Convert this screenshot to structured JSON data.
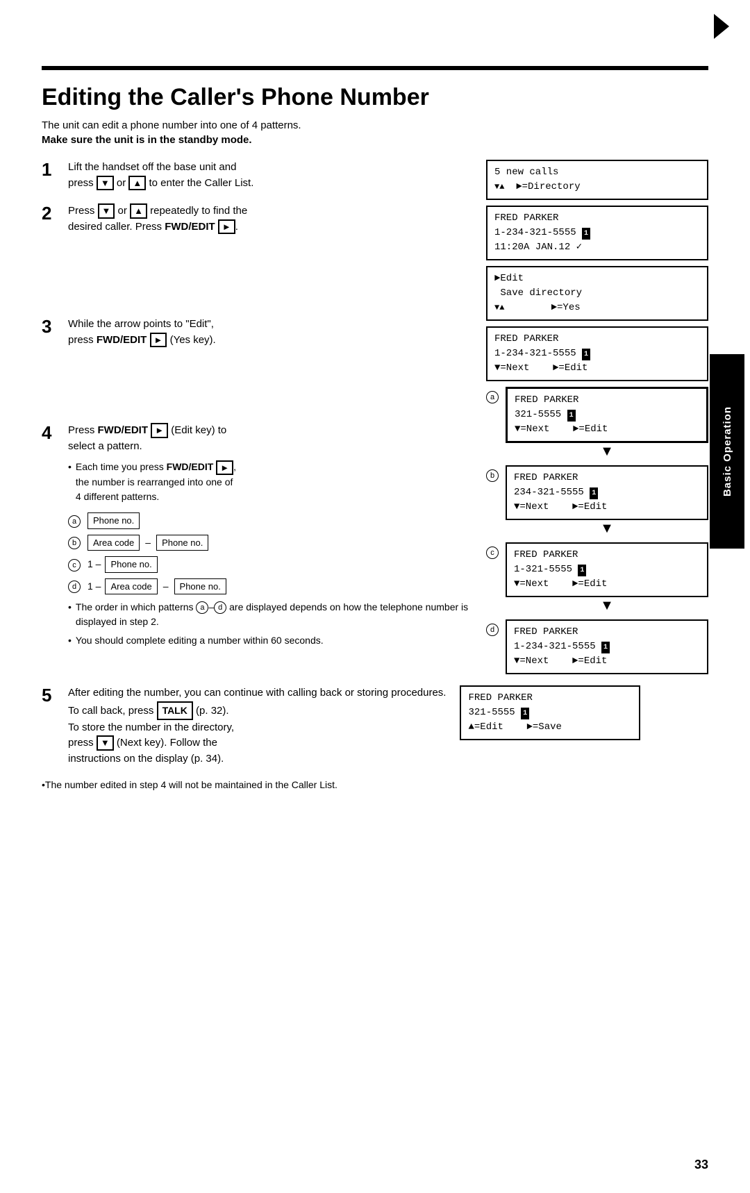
{
  "page": {
    "number": "33",
    "top_arrow": "►"
  },
  "title": "Editing the Caller's Phone Number",
  "intro": {
    "line1": "The unit can edit a phone number into one of 4 patterns.",
    "line2": "Make sure the unit is in the standby mode."
  },
  "steps": [
    {
      "number": "1",
      "text": "Lift the handset off the base unit and press",
      "text2": "or",
      "text3": "to enter the Caller List.",
      "btn1": "▼",
      "btn2": "▲"
    },
    {
      "number": "2",
      "text": "Press",
      "text2": "or",
      "text3": "repeatedly to find the desired caller. Press",
      "text4": "FWD/EDIT",
      "btn1": "▼",
      "btn2": "▲",
      "btn3": "►"
    },
    {
      "number": "3",
      "text": "While the arrow points to \"Edit\", press",
      "text2": "FWD/EDIT",
      "btn1": "►",
      "text3": "(Yes key)."
    },
    {
      "number": "4",
      "text": "Press",
      "text2": "FWD/EDIT",
      "btn1": "►",
      "text3": "(Edit key) to select a pattern.",
      "bullet1": "Each time you press",
      "bullet1_btn": "FWD/EDIT",
      "bullet1_btn_icon": "►",
      "bullet1_rest": ", the number is rearranged into one of 4 different patterns."
    }
  ],
  "patterns": [
    {
      "label": "a",
      "items": [
        "Phone no."
      ]
    },
    {
      "label": "b",
      "items": [
        "Area code",
        "–",
        "Phone no."
      ]
    },
    {
      "label": "c",
      "prefix": "1 –",
      "items": [
        "Phone no."
      ]
    },
    {
      "label": "d",
      "prefix": "1 –",
      "items": [
        "Area code",
        "–",
        "Phone no."
      ]
    }
  ],
  "pattern_bullets": [
    "The order in which patterns ⓐ–ⓓ are displayed depends on how the telephone number is displayed in step 2.",
    "You should complete editing a number within 60 seconds."
  ],
  "displays": {
    "step1": {
      "line1": "5 new calls",
      "line2": "▼▲  ►=Directory"
    },
    "step2": {
      "line1": "FRED PARKER",
      "line2": "1-234-321-5555",
      "icon": "1",
      "line3": "11:20A JAN.12 ✓"
    },
    "step2b": {
      "line1": "►Edit",
      "line2": " Save directory",
      "line3": "▼▲        ►=Yes"
    },
    "step3": {
      "line1": "FRED PARKER",
      "line2": "1-234-321-5555",
      "icon": "1",
      "line3": "▼=Next    ►=Edit"
    },
    "diagram_a": {
      "line1": "FRED PARKER",
      "line2": "321-5555",
      "icon": "1",
      "line3": "▼=Next    ►=Edit"
    },
    "diagram_b": {
      "line1": "FRED PARKER",
      "line2": "234-321-5555",
      "icon": "1",
      "line3": "▼=Next    ►=Edit"
    },
    "diagram_c": {
      "line1": "FRED PARKER",
      "line2": "1-321-5555",
      "icon": "1",
      "line3": "▼=Next    ►=Edit"
    },
    "diagram_d": {
      "line1": "FRED PARKER",
      "line2": "1-234-321-5555",
      "icon": "1",
      "line3": "▼=Next    ►=Edit"
    }
  },
  "step5": {
    "number": "5",
    "line1": "After editing the number, you can continue with calling back or storing procedures.",
    "line2": "To call back, press",
    "talk_btn": "TALK",
    "line2b": "(p. 32).",
    "line3": "To store the number in the directory,",
    "line4": "press",
    "next_btn": "▼",
    "line4b": "(Next key). Follow the instructions on the display (p. 34).",
    "display": {
      "line1": "FRED PARKER",
      "line2": "321-5555",
      "icon": "1",
      "line3": "▲=Edit    ►=Save"
    }
  },
  "bottom_note": "•The number edited in step 4 will not be maintained in the Caller List.",
  "sidebar_label": "Basic Operation"
}
